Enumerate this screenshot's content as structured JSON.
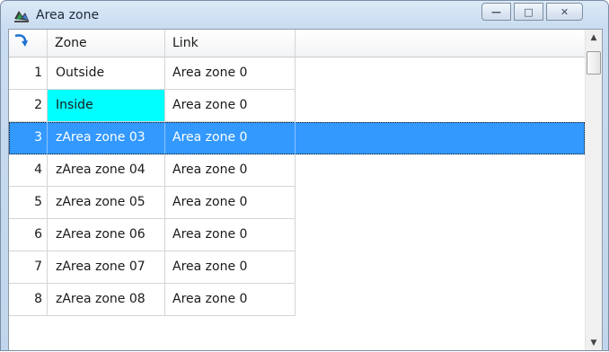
{
  "window": {
    "title": "Area zone",
    "icon": "area-zone-app-icon",
    "buttons": {
      "minimize": "—",
      "maximize": "□",
      "close": "✕"
    }
  },
  "table": {
    "corner_icon": "refresh-arrow-icon",
    "columns": [
      "Zone",
      "Link"
    ],
    "rows": [
      {
        "num": "1",
        "zone": "Outside",
        "link": "Area zone 0"
      },
      {
        "num": "2",
        "zone": "Inside",
        "link": "Area zone 0",
        "zone_highlight": "#00ffff"
      },
      {
        "num": "3",
        "zone": "zArea zone 03",
        "link": "Area zone 0",
        "selected": true
      },
      {
        "num": "4",
        "zone": "zArea zone 04",
        "link": "Area zone 0"
      },
      {
        "num": "5",
        "zone": "zArea zone 05",
        "link": "Area zone 0"
      },
      {
        "num": "6",
        "zone": "zArea zone 06",
        "link": "Area zone 0"
      },
      {
        "num": "7",
        "zone": "zArea zone 07",
        "link": "Area zone 0"
      },
      {
        "num": "8",
        "zone": "zArea zone 08",
        "link": "Area zone 0"
      }
    ]
  },
  "scrollbar": {
    "up_icon": "scroll-up-arrow-icon",
    "down_icon": "scroll-down-arrow-icon"
  },
  "colors": {
    "selection": "#3399ff",
    "highlight": "#00ffff",
    "frame": "#c9dcf0"
  }
}
